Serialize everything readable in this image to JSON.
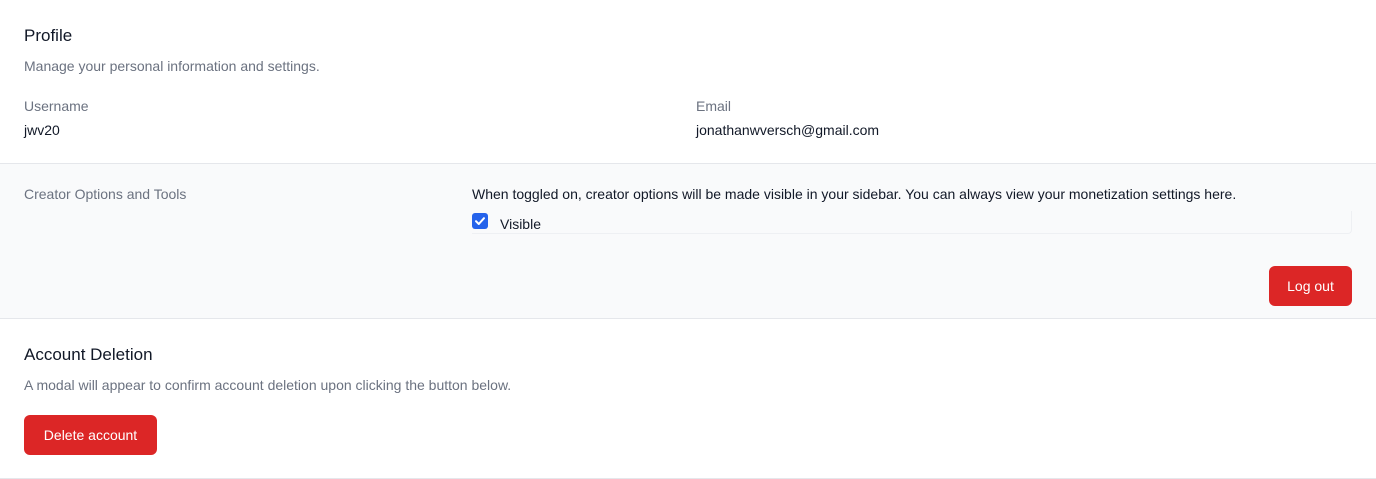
{
  "profile": {
    "title": "Profile",
    "subtitle": "Manage your personal information and settings.",
    "username_label": "Username",
    "username_value": "jwv20",
    "email_label": "Email",
    "email_value": "jonathanwversch@gmail.com"
  },
  "creator": {
    "label": "Creator Options and Tools",
    "description": "When toggled on, creator options will be made visible in your sidebar. You can always view your monetization settings here.",
    "checkbox_label": "Visible",
    "checkbox_checked": true,
    "logout_label": "Log out"
  },
  "deletion": {
    "title": "Account Deletion",
    "subtitle": "A modal will appear to confirm account deletion upon clicking the button below.",
    "delete_label": "Delete account"
  },
  "colors": {
    "danger": "#dc2626",
    "checkbox": "#2563eb",
    "muted_bg": "#f9fafb"
  },
  "icons": {
    "checkbox": "checkmark-icon"
  }
}
